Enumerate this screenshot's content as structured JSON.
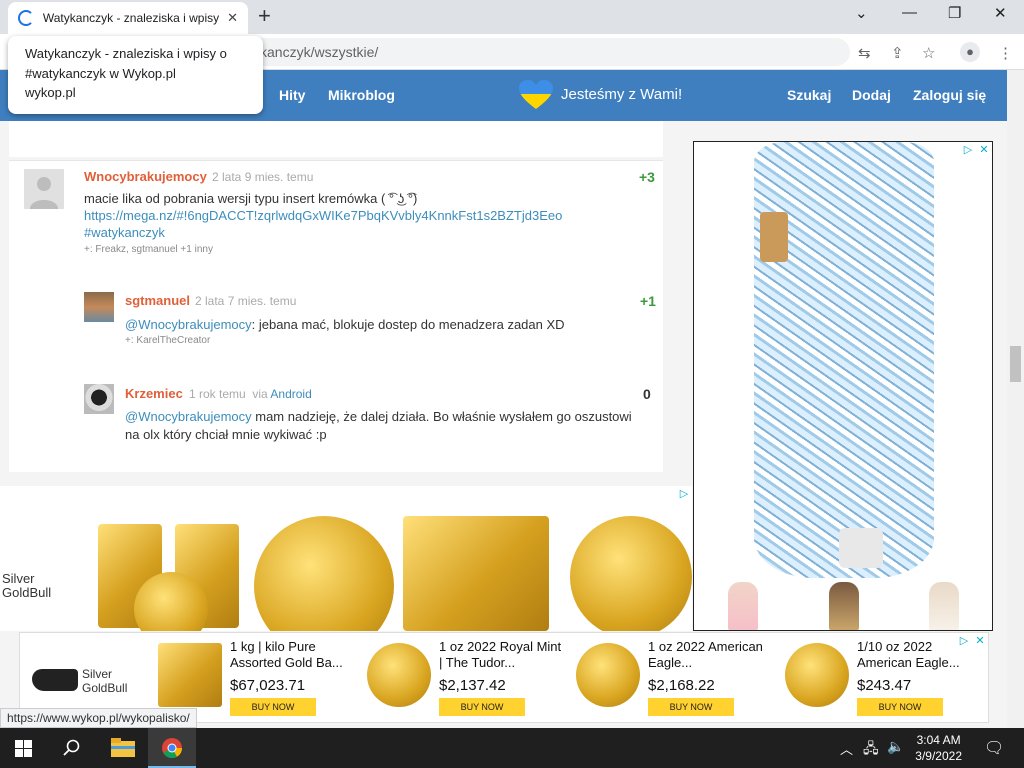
{
  "browser": {
    "tab_title": "Watykanczyk - znaleziska i wpisy",
    "tab_close": "✕",
    "new_tab": "+",
    "address": "kanczyk/wszystkie/",
    "tooltip_title": "Watykanczyk - znaleziska i wpisy o #watykanczyk w Wykop.pl",
    "tooltip_url": "wykop.pl",
    "minimize": "—",
    "restore": "❐",
    "close": "✕"
  },
  "nav": {
    "hity": "Hity",
    "mikroblog": "Mikroblog",
    "slogan": "Jesteśmy z Wami!",
    "szukaj": "Szukaj",
    "dodaj": "Dodaj",
    "zaloguj": "Zaloguj się"
  },
  "entries": [
    {
      "user": "Wnocybrakujemocy",
      "time": "2 lata 9 mies. temu",
      "score": "+3",
      "text1": "macie lika od pobrania wersji typu insert kremówka ( ͡° ͜ʖ ͡°)",
      "link": "https://mega.nz/#!6ngDACCT!zqrlwdqGxWIKe7PbqKVvbly4KnnkFst1s2BZTjd3Eeo",
      "tag": "#watykanczyk",
      "voters": "+: Freakz, sgtmanuel +1 inny"
    },
    {
      "user": "sgtmanuel",
      "time": "2 lata 7 mies. temu",
      "score": "+1",
      "mention": "@Wnocybrakujemocy",
      "text": ": jebana mać, blokuje dostep do menadzera zadan XD",
      "voters": "+: KarelTheCreator"
    },
    {
      "user": "Krzemiec",
      "time": "1 rok temu",
      "via_label": "via",
      "via": "Android",
      "score": "0",
      "mention": "@Wnocybrakujemocy",
      "text1": " mam nadzieję, że dalej działa. Bo właśnie wysłałem go oszustowi",
      "text2": "na olx który chciał mnie wykiwać :p"
    }
  ],
  "ads": {
    "brand_line1": "Silver",
    "brand_line2": "GoldBull",
    "products": [
      {
        "title": "1 kg | kilo Pure Assorted Gold Ba...",
        "price": "$67,023.71",
        "button": "BUY NOW"
      },
      {
        "title": "1 oz 2022 Royal Mint | The Tudor...",
        "price": "$2,137.42",
        "button": "BUY NOW"
      },
      {
        "title": "1 oz 2022 American Eagle...",
        "price": "$2,168.22",
        "button": "BUY NOW"
      },
      {
        "title": "1/10 oz 2022 American Eagle...",
        "price": "$243.47",
        "button": "BUY NOW"
      }
    ]
  },
  "status_url": "https://www.wykop.pl/wykopalisko/",
  "taskbar": {
    "time": "3:04 AM",
    "date": "3/9/2022"
  }
}
